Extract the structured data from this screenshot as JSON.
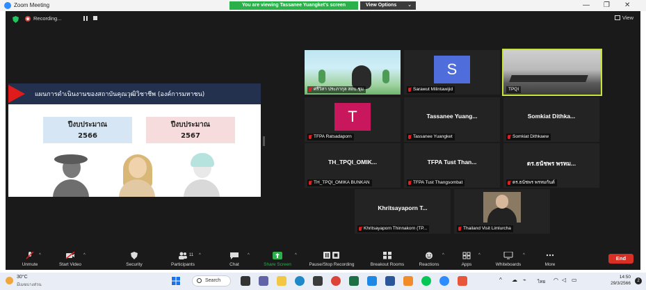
{
  "window": {
    "title": "Zoom Meeting",
    "share_banner": "You are viewing Tassanee Yuangket's screen",
    "view_options": "View Options",
    "minimize": "—",
    "restore": "❐",
    "close": "✕"
  },
  "meeting_header": {
    "recording": "Recording...",
    "view": "View"
  },
  "slide": {
    "title": "แผนการดำเนินงานของสถาบันคุณวุฒิวิชาชีพ (องค์การมหาชน)",
    "budget_left_label": "ปีงบประมาณ",
    "budget_left_year": "2566",
    "budget_right_label": "ปีงบประมาณ",
    "budget_right_year": "2567"
  },
  "tiles": [
    {
      "name": "ศรีวิสา ประภากุล สถบ.ชุม",
      "type": "video"
    },
    {
      "name": "Sarawut Milintawijid",
      "initial": "S",
      "initial_color": "#4f6edb"
    },
    {
      "name": "TPQI",
      "type": "video"
    },
    {
      "name": "TFPA Ratsadaporn",
      "initial": "T",
      "initial_color": "#c8175c"
    },
    {
      "name": "Tassanee Yuangket",
      "big": "Tassanee Yuang..."
    },
    {
      "name": "Somkiat Dithkaew",
      "big": "Somkiat Dithka..."
    },
    {
      "name": "TH_TPQI_OMIKA BUNKAN",
      "big": "TH_TPQI_OMIK..."
    },
    {
      "name": "TFPA Tust Thangsombat",
      "big": "TFPA Tust Than..."
    },
    {
      "name": "ดร.ธนัชพร พรหมกันต์",
      "big": "ดร.ธนัชพร พรหม..."
    },
    {
      "name": "Khritsayaporn Thinnakorn (TP...",
      "big": "Khritsayaporn T..."
    },
    {
      "name": "Thailand Visit Limlurcha",
      "type": "video"
    }
  ],
  "toolbar": {
    "unmute": "Unmute",
    "start_video": "Start Video",
    "security": "Security",
    "participants": "Participants",
    "participants_count": "11",
    "chat": "Chat",
    "share_screen": "Share Screen",
    "pause_recording": "Pause/Stop Recording",
    "breakout": "Breakout Rooms",
    "reactions": "Reactions",
    "apps": "Apps",
    "whiteboards": "Whiteboards",
    "more": "More",
    "end": "End"
  },
  "taskbar": {
    "temp": "30°C",
    "weather": "มีเมฆบางส่วน",
    "search": "Search",
    "lang": "ไทย",
    "time": "14:50",
    "date": "29/3/2566",
    "notifications": "2"
  },
  "colors": {
    "share_green": "#2bb14a",
    "end_red": "#d93025",
    "slide_header": "#23314f",
    "speaker_highlight": "#c7e43a"
  }
}
